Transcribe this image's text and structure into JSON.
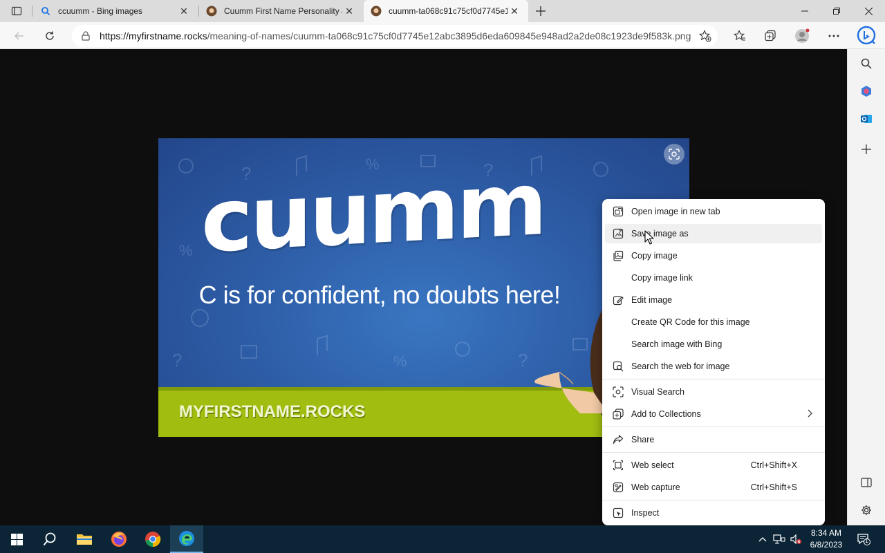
{
  "tabs": [
    {
      "title": "ccuumm - Bing images",
      "favicon": "bing-search-icon"
    },
    {
      "title": "Cuumm First Name Personality &",
      "favicon": "myfirstname-favicon"
    },
    {
      "title": "cuumm-ta068c91c75cf0d7745e1",
      "favicon": "myfirstname-favicon"
    }
  ],
  "address_bar": {
    "url_host": "https://myfirstname.rocks",
    "url_path": "/meaning-of-names/cuumm-ta068c91c75cf0d7745e12abc3895d6eda609845e948ad2a2de08c1923de9f583k.png"
  },
  "image": {
    "name": "cuumm",
    "tagline": "C is for confident, no doubts here!",
    "brand": "MYFIRSTNAME.ROCKS"
  },
  "context_menu": {
    "groups": [
      [
        {
          "label": "Open image in new tab",
          "icon": "open-new-tab-icon"
        },
        {
          "label": "Save image as",
          "icon": "save-image-icon",
          "hover": true
        },
        {
          "label": "Copy image",
          "icon": "copy-image-icon"
        },
        {
          "label": "Copy image link",
          "icon": ""
        },
        {
          "label": "Edit image",
          "icon": "edit-image-icon"
        },
        {
          "label": "Create QR Code for this image",
          "icon": ""
        },
        {
          "label": "Search image with Bing",
          "icon": ""
        },
        {
          "label": "Search the web for image",
          "icon": "search-web-image-icon"
        }
      ],
      [
        {
          "label": "Visual Search",
          "icon": "visual-search-icon"
        },
        {
          "label": "Add to Collections",
          "icon": "collections-icon",
          "submenu": true
        }
      ],
      [
        {
          "label": "Share",
          "icon": "share-icon"
        }
      ],
      [
        {
          "label": "Web select",
          "icon": "web-select-icon",
          "shortcut": "Ctrl+Shift+X"
        },
        {
          "label": "Web capture",
          "icon": "web-capture-icon",
          "shortcut": "Ctrl+Shift+S"
        }
      ],
      [
        {
          "label": "Inspect",
          "icon": "inspect-icon"
        }
      ]
    ]
  },
  "taskbar": {
    "time": "8:34 AM",
    "date": "6/8/2023",
    "notifications": "1"
  },
  "colors": {
    "accent": "#0078d4",
    "image_blue": "#2e5ea8",
    "image_band": "#a1bd10",
    "taskbar": "#0b2536"
  }
}
